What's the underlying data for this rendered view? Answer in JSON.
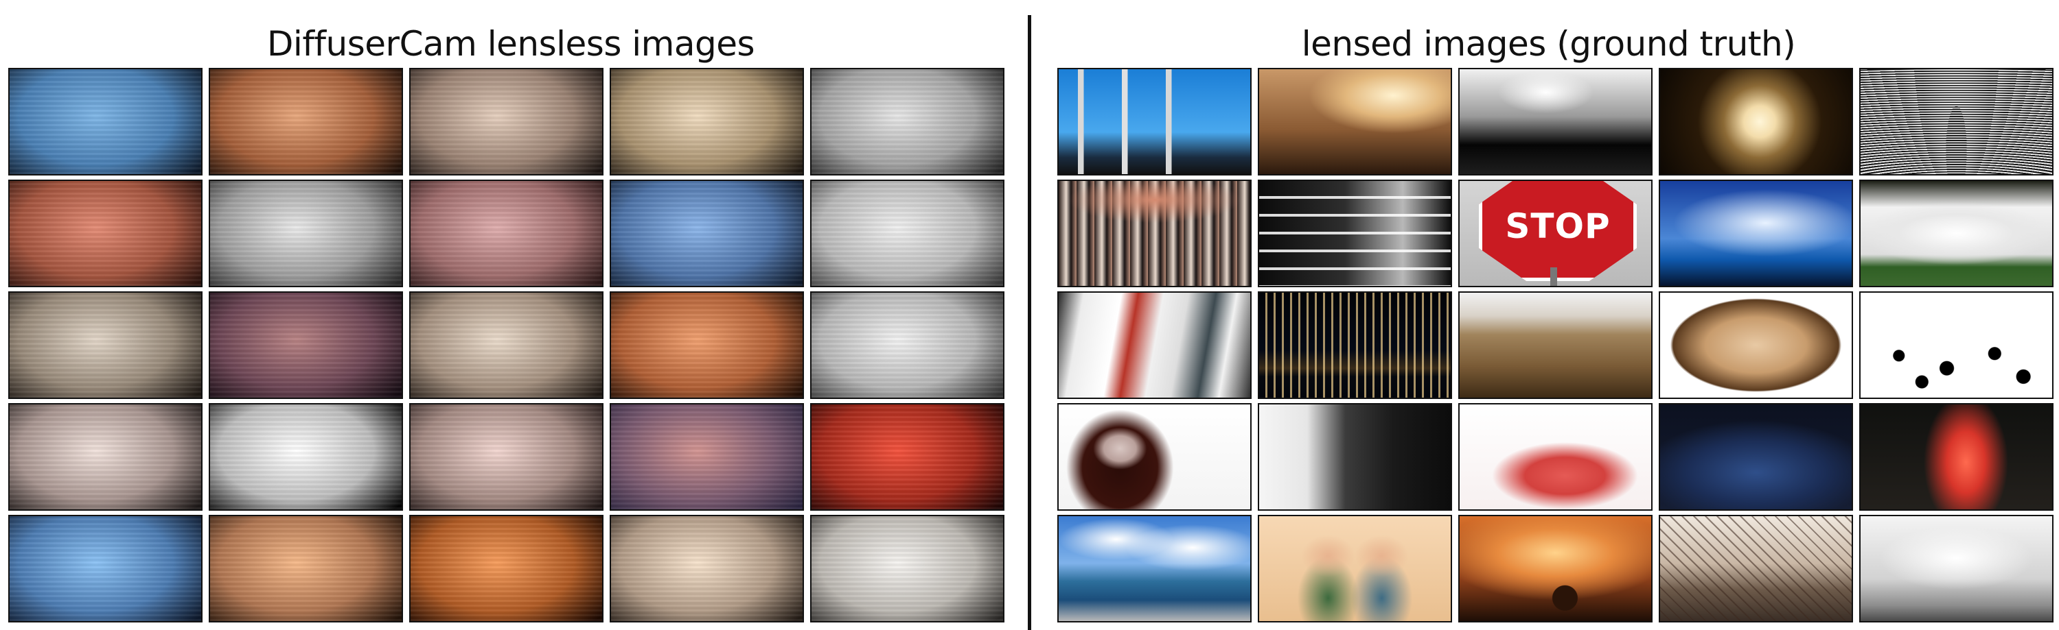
{
  "left_panel": {
    "title": "DiffuserCam lensless images",
    "tiles": [
      {
        "name": "lensless-blue",
        "colors": [
          "#7fb6e6",
          "#4a7fb3",
          "#0e1a2a"
        ]
      },
      {
        "name": "lensless-orange",
        "colors": [
          "#e7a77d",
          "#a45f3a",
          "#1d0f08"
        ]
      },
      {
        "name": "lensless-beige",
        "colors": [
          "#e5cfbe",
          "#9a8273",
          "#1c1512"
        ]
      },
      {
        "name": "lensless-tan",
        "colors": [
          "#f0dcc0",
          "#a8916f",
          "#1e1710"
        ]
      },
      {
        "name": "lensless-gray",
        "colors": [
          "#e6e6e6",
          "#a3a3a3",
          "#242424"
        ]
      },
      {
        "name": "lensless-rust",
        "colors": [
          "#e38c76",
          "#a4553f",
          "#2a120d"
        ]
      },
      {
        "name": "lensless-silver",
        "colors": [
          "#e9e9e9",
          "#9d9d9d",
          "#2a2a2a"
        ]
      },
      {
        "name": "lensless-rose",
        "colors": [
          "#dfaeae",
          "#9e6c6c",
          "#2a1717"
        ]
      },
      {
        "name": "lensless-steel-blue",
        "colors": [
          "#8db6ea",
          "#4f74a8",
          "#101b2c"
        ]
      },
      {
        "name": "lensless-light-gray",
        "colors": [
          "#efefef",
          "#b8b8b8",
          "#3a3a3a"
        ]
      },
      {
        "name": "lensless-taupe",
        "colors": [
          "#e2d6c8",
          "#978979",
          "#1e1814"
        ]
      },
      {
        "name": "lensless-mauve",
        "colors": [
          "#b88384",
          "#6d4655",
          "#140b12"
        ]
      },
      {
        "name": "lensless-sand",
        "colors": [
          "#eadbcb",
          "#a38f7e",
          "#201914"
        ]
      },
      {
        "name": "lensless-copper",
        "colors": [
          "#f0a070",
          "#b05f35",
          "#200e05"
        ]
      },
      {
        "name": "lensless-pale-gray",
        "colors": [
          "#f1f1f1",
          "#b6b6b6",
          "#353535"
        ]
      },
      {
        "name": "lensless-blush",
        "colors": [
          "#f1e2dc",
          "#a89590",
          "#1e1918"
        ]
      },
      {
        "name": "lensless-white-gray",
        "colors": [
          "#ffffff",
          "#bdbdbd",
          "#050505"
        ]
      },
      {
        "name": "lensless-pink-beige",
        "colors": [
          "#f2d6d0",
          "#a38982",
          "#221817"
        ]
      },
      {
        "name": "lensless-dusk",
        "colors": [
          "#d39592",
          "#7a5a70",
          "#2b2540"
        ]
      },
      {
        "name": "lensless-red",
        "colors": [
          "#f3533e",
          "#a52a1c",
          "#200605"
        ]
      },
      {
        "name": "lensless-sky",
        "colors": [
          "#8cc2f4",
          "#4d7cb2",
          "#0e192c"
        ]
      },
      {
        "name": "lensless-peach",
        "colors": [
          "#f5b98a",
          "#b07652",
          "#24140a"
        ]
      },
      {
        "name": "lensless-amber",
        "colors": [
          "#f69d5d",
          "#b05b25",
          "#1e0a02"
        ]
      },
      {
        "name": "lensless-cream",
        "colors": [
          "#f6e2cc",
          "#b09a86",
          "#241c16"
        ]
      },
      {
        "name": "lensless-ivory",
        "colors": [
          "#f5f3f0",
          "#bcb8b2",
          "#2a2826"
        ]
      }
    ]
  },
  "right_panel": {
    "title": "lensed images (ground truth)",
    "tiles": [
      {
        "name": "smokestacks-photo",
        "scene": "smokestacks"
      },
      {
        "name": "golden-sunset-water-photo",
        "scene": "golden-haze"
      },
      {
        "name": "handstand-silhouette-photo",
        "scene": "silhouette"
      },
      {
        "name": "dandelion-seedhead-photo",
        "scene": "dandelion"
      },
      {
        "name": "monochrome-curves-photo",
        "scene": "mono-curves"
      },
      {
        "name": "group-portrait-photo",
        "scene": "crowd"
      },
      {
        "name": "building-facade-photo",
        "scene": "facade"
      },
      {
        "name": "stop-sign-photo",
        "scene": "stop-sign",
        "sign_text": "STOP"
      },
      {
        "name": "blue-sky-lake-photo",
        "scene": "blue-sky"
      },
      {
        "name": "park-trees-photo",
        "scene": "park"
      },
      {
        "name": "polaroid-prints-photo",
        "scene": "polaroids"
      },
      {
        "name": "city-skyline-night-photo",
        "scene": "night-city"
      },
      {
        "name": "wheat-field-photo",
        "scene": "field"
      },
      {
        "name": "textured-dome-photo",
        "scene": "dome"
      },
      {
        "name": "birds-on-snow-photo",
        "scene": "birds"
      },
      {
        "name": "dark-haired-woman-photo",
        "scene": "woman-white"
      },
      {
        "name": "window-figure-photo",
        "scene": "window-figure"
      },
      {
        "name": "paper-lotus-photo",
        "scene": "lotus"
      },
      {
        "name": "reclining-woman-blue-photo",
        "scene": "blue-dress"
      },
      {
        "name": "woman-red-light-photo",
        "scene": "red-woman"
      },
      {
        "name": "coastline-clouds-photo",
        "scene": "coast"
      },
      {
        "name": "wooden-doll-family-photo",
        "scene": "dolls"
      },
      {
        "name": "orange-sunset-tree-photo",
        "scene": "sunset-tree"
      },
      {
        "name": "roller-coaster-photo",
        "scene": "coaster"
      },
      {
        "name": "foggy-street-photo",
        "scene": "fog"
      }
    ]
  }
}
